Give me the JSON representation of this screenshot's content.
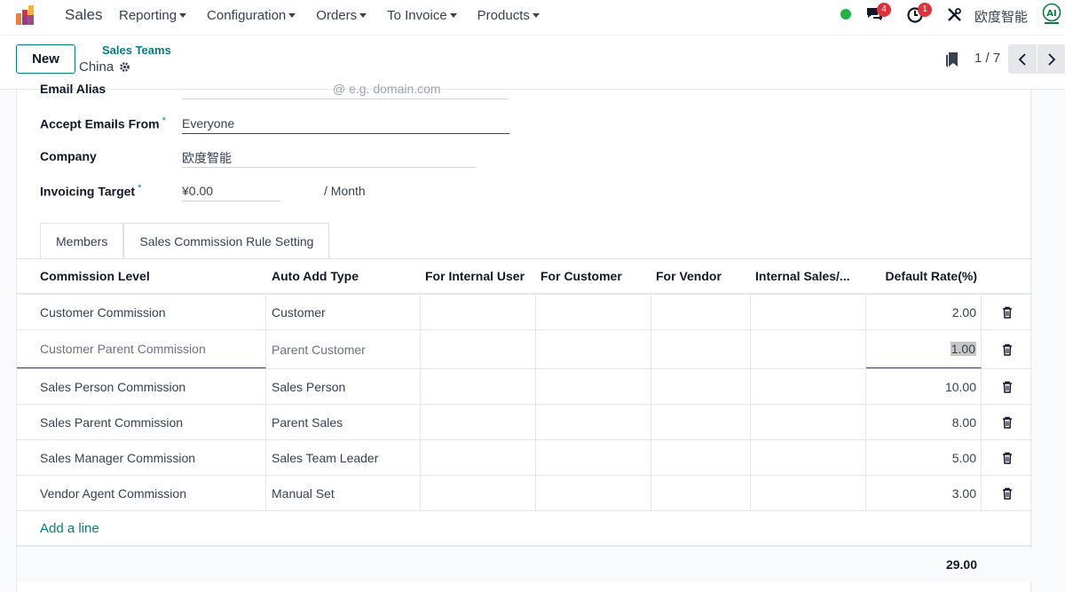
{
  "navbar": {
    "app_name": "Sales",
    "menu": [
      "Reporting",
      "Configuration",
      "Orders",
      "To Invoice",
      "Products"
    ],
    "chat_count": "4",
    "activity_count": "1",
    "company": "欧度智能"
  },
  "control_panel": {
    "new_label": "New",
    "breadcrumb": "Sales Teams",
    "record": "China",
    "pager": "1 / 7"
  },
  "form": {
    "email_alias_label": "Email Alias",
    "email_alias_placeholder": "@ e.g. domain.com",
    "accept_emails_label": "Accept Emails From",
    "accept_emails_value": "Everyone",
    "company_label": "Company",
    "company_value": "欧度智能",
    "invoicing_target_label": "Invoicing Target",
    "invoicing_target_value": "¥0.00",
    "invoicing_target_unit": "/ Month"
  },
  "tabs": [
    "Members",
    "Sales Commission Rule Setting"
  ],
  "table": {
    "headers": [
      "Commission Level",
      "Auto Add Type",
      "For Internal User",
      "For Customer",
      "For Vendor",
      "Internal Sales/...",
      "Default Rate(%)"
    ],
    "rows": [
      {
        "level": "Customer Commission",
        "type": "Customer",
        "rate": "2.00"
      },
      {
        "level": "Customer Parent Commission",
        "type": "Parent Customer",
        "rate": "1.00"
      },
      {
        "level": "Sales Person Commission",
        "type": "Sales Person",
        "rate": "10.00"
      },
      {
        "level": "Sales Parent Commission",
        "type": "Parent Sales",
        "rate": "8.00"
      },
      {
        "level": "Sales Manager Commission",
        "type": "Sales Team Leader",
        "rate": "5.00"
      },
      {
        "level": "Vendor Agent Commission",
        "type": "Manual Set",
        "rate": "3.00"
      }
    ],
    "add_line": "Add a line",
    "total": "29.00"
  },
  "colors": {
    "accent": "#017e84",
    "badge": "#e0313b",
    "online": "#21b24a"
  }
}
